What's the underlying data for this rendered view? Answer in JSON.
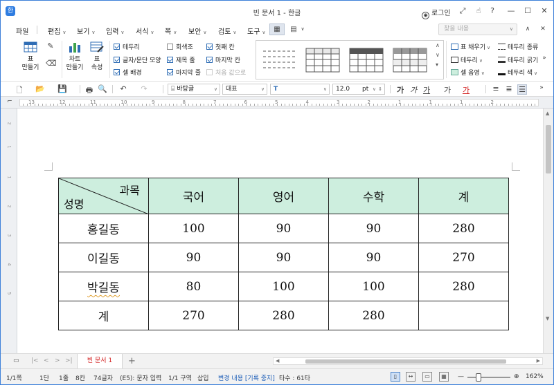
{
  "window": {
    "title": "빈 문서 1 - 한글",
    "app_icon": "한",
    "login_label": "로그인"
  },
  "menu": {
    "items": [
      {
        "label": "파일",
        "caret": false
      },
      {
        "label": "편집",
        "caret": true
      },
      {
        "label": "보기",
        "caret": true
      },
      {
        "label": "입력",
        "caret": true
      },
      {
        "label": "서식",
        "caret": true
      },
      {
        "label": "쪽",
        "caret": true
      },
      {
        "label": "보안",
        "caret": true
      },
      {
        "label": "검토",
        "caret": true
      },
      {
        "label": "도구",
        "caret": true
      }
    ],
    "search_placeholder": "찾을 내용"
  },
  "ribbon": {
    "make_table": "표\n만들기",
    "make_chart": "차트\n만들기",
    "table_props": "표\n속성",
    "checks": [
      {
        "label": "테두리",
        "checked": true
      },
      {
        "label": "글자/문단 모양",
        "checked": true
      },
      {
        "label": "셀 배경",
        "checked": true
      },
      {
        "label": "회색조",
        "checked": false
      },
      {
        "label": "제목 줄",
        "checked": true
      },
      {
        "label": "마지막 줄",
        "checked": true
      },
      {
        "label": "첫째 칸",
        "checked": true
      },
      {
        "label": "마지막 칸",
        "checked": true
      },
      {
        "label": "처음 값으로",
        "checked": false,
        "disabled": true
      }
    ],
    "right": {
      "fill": "표 채우기",
      "border_type": "테두리 종류",
      "border": "테두리",
      "border_width": "테두리 굵기",
      "cell_color": "셀 음영",
      "border_color": "테두리 색"
    }
  },
  "format_bar": {
    "style": "바탕글",
    "lang": "대표",
    "font": "",
    "size": "12.0",
    "unit": "pt",
    "bold": "가",
    "italic": "가",
    "underline": "가",
    "strike": "가",
    "color_char": "가"
  },
  "ruler": {
    "numbers": [
      "13",
      "12",
      "11",
      "10",
      "9",
      "8",
      "7",
      "6",
      "5",
      "4",
      "3",
      "2",
      "1",
      "1",
      "1",
      "2"
    ]
  },
  "table": {
    "diag_top": "과목",
    "diag_bottom": "성명",
    "headers": [
      "국어",
      "영어",
      "수학",
      "계"
    ],
    "rows": [
      {
        "name": "홍길동",
        "values": [
          "100",
          "90",
          "90",
          "280"
        ]
      },
      {
        "name": "이길동",
        "values": [
          "90",
          "90",
          "90",
          "270"
        ]
      },
      {
        "name": "박길동",
        "values": [
          "80",
          "100",
          "100",
          "280"
        ]
      },
      {
        "name": "계",
        "values": [
          "270",
          "280",
          "280",
          ""
        ]
      }
    ],
    "header_color": "#cdeede"
  },
  "tabs": {
    "doc_tab": "빈 문서 1"
  },
  "status": {
    "page": "1/1쪽",
    "column": "1단",
    "line": "1줄",
    "col": "8칸",
    "chars": "74글자",
    "input_mode": "(E5): 문자 입력",
    "section": "1/1 구역",
    "insert": "삽입",
    "track": "변경 내용 [기록 중지]",
    "keys": "타수 : 61타",
    "zoom": "162%"
  }
}
